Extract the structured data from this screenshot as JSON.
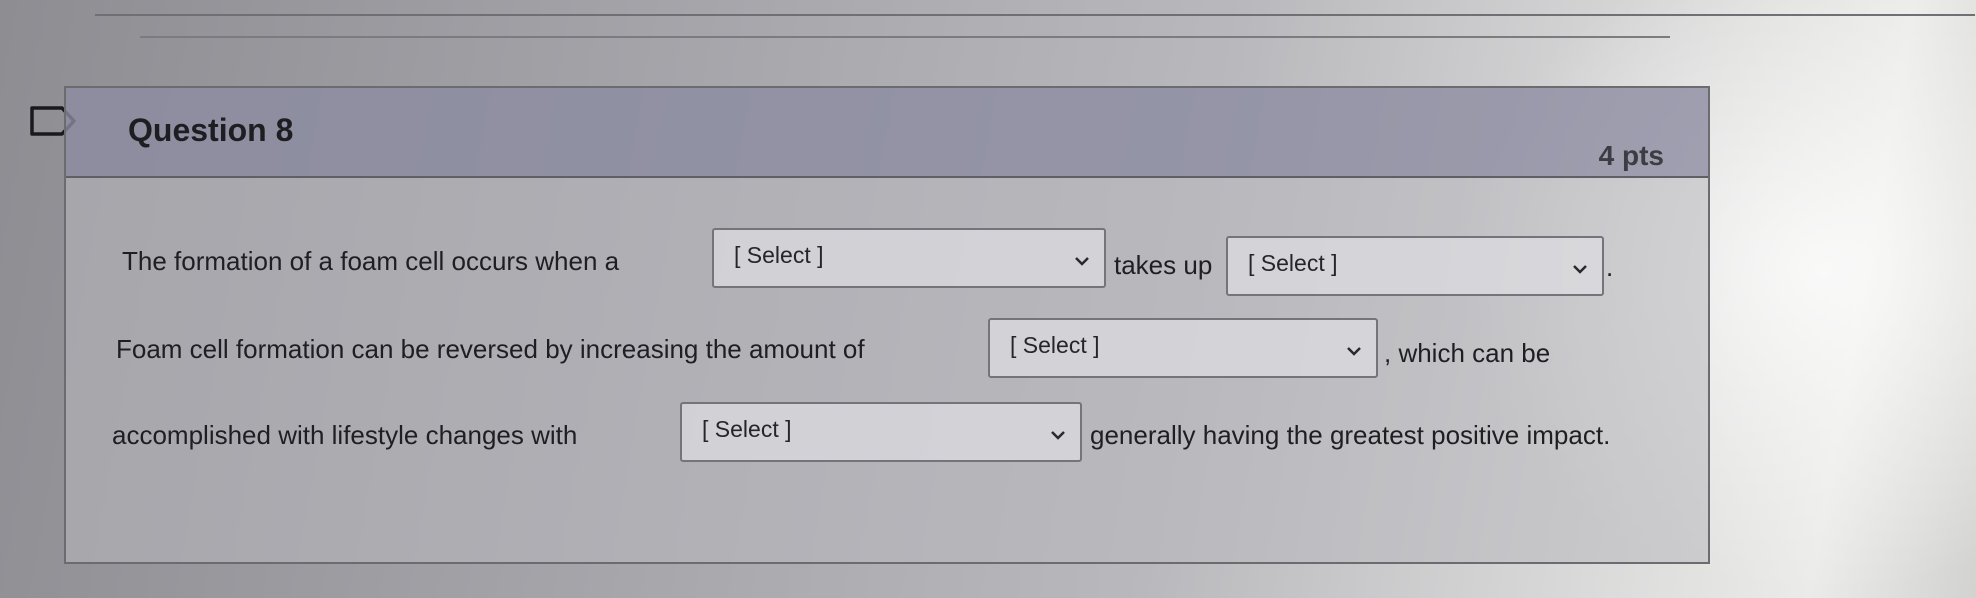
{
  "question": {
    "title": "Question 8",
    "points": "4 pts"
  },
  "sentence1": {
    "part1": "The formation of a foam cell occurs when a",
    "part2": "takes up",
    "part3": "."
  },
  "sentence2": {
    "part1": "Foam cell formation can be reversed by increasing the amount of",
    "part2": ", which can be"
  },
  "sentence3": {
    "part1": "accomplished with lifestyle changes with",
    "part2": "generally having the greatest positive impact."
  },
  "selects": {
    "placeholder": "[ Select ]"
  },
  "icons": {
    "flag": "flag-outline-icon",
    "chevron": "chevron-down-icon"
  }
}
